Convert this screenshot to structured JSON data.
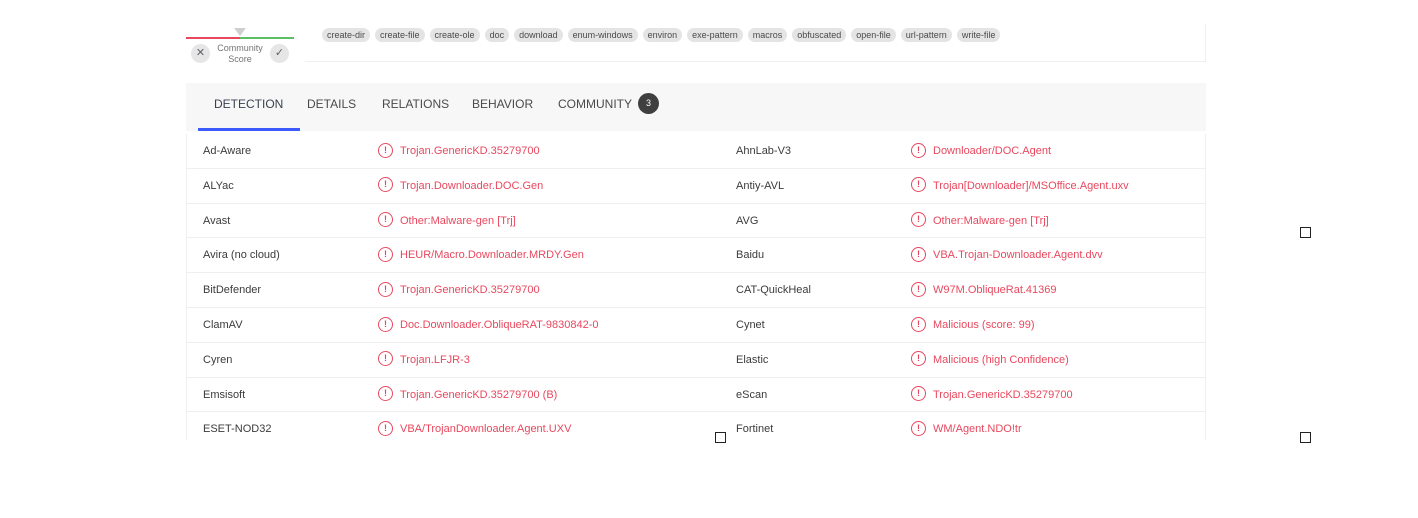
{
  "community_score": {
    "label": "Community Score",
    "down_icon": "close-icon",
    "up_icon": "check-icon",
    "colors": {
      "negative": "#e8485e",
      "positive": "#5bbf6a"
    }
  },
  "tags": [
    "create-dir",
    "create-file",
    "create-ole",
    "doc",
    "download",
    "enum-windows",
    "environ",
    "exe-pattern",
    "macros",
    "obfuscated",
    "open-file",
    "url-pattern",
    "write-file"
  ],
  "tabs": [
    {
      "label": "DETECTION",
      "active": true
    },
    {
      "label": "DETAILS",
      "active": false
    },
    {
      "label": "RELATIONS",
      "active": false
    },
    {
      "label": "BEHAVIOR",
      "active": false
    },
    {
      "label": "COMMUNITY",
      "active": false,
      "count": "3"
    }
  ],
  "accent_color": "#3d5afe",
  "malicious_color": "#e8485e",
  "detections": [
    {
      "engine": "Ad-Aware",
      "result": "Trojan.GenericKD.35279700"
    },
    {
      "engine": "AhnLab-V3",
      "result": "Downloader/DOC.Agent"
    },
    {
      "engine": "ALYac",
      "result": "Trojan.Downloader.DOC.Gen"
    },
    {
      "engine": "Antiy-AVL",
      "result": "Trojan[Downloader]/MSOffice.Agent.uxv"
    },
    {
      "engine": "Avast",
      "result": "Other:Malware-gen [Trj]"
    },
    {
      "engine": "AVG",
      "result": "Other:Malware-gen [Trj]"
    },
    {
      "engine": "Avira (no cloud)",
      "result": "HEUR/Macro.Downloader.MRDY.Gen"
    },
    {
      "engine": "Baidu",
      "result": "VBA.Trojan-Downloader.Agent.dvv"
    },
    {
      "engine": "BitDefender",
      "result": "Trojan.GenericKD.35279700"
    },
    {
      "engine": "CAT-QuickHeal",
      "result": "W97M.ObliqueRat.41369"
    },
    {
      "engine": "ClamAV",
      "result": "Doc.Downloader.ObliqueRAT-9830842-0"
    },
    {
      "engine": "Cynet",
      "result": "Malicious (score: 99)"
    },
    {
      "engine": "Cyren",
      "result": "Trojan.LFJR-3"
    },
    {
      "engine": "Elastic",
      "result": "Malicious (high Confidence)"
    },
    {
      "engine": "Emsisoft",
      "result": "Trojan.GenericKD.35279700 (B)"
    },
    {
      "engine": "eScan",
      "result": "Trojan.GenericKD.35279700"
    },
    {
      "engine": "ESET-NOD32",
      "result": "VBA/TrojanDownloader.Agent.UXV"
    },
    {
      "engine": "Fortinet",
      "result": "WM/Agent.NDO!tr"
    }
  ]
}
